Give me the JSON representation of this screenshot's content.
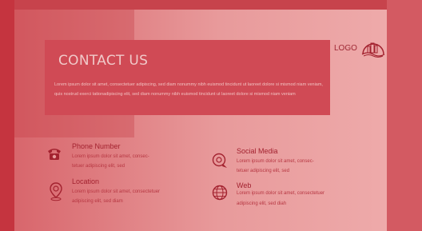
{
  "header": {
    "title": "CONTACT US",
    "text": "Lorem ipsum dolor sit amet, consectetuer adipiscing, sed diam nonummy nibh euismod tincidunt ut laoreet dolore si mismod niam veniam, quis nostrud exerci tationadipiscing elit, sed diam nonummy nibh euismod tincidunt ut laoreet dolore si mismod niam veniam"
  },
  "logo": {
    "label": "LOGO",
    "icon": "city-skyline-logo-icon"
  },
  "contacts": [
    {
      "id": "phone",
      "icon": "phone-icon",
      "title": "Phone Number",
      "line1": "Lorem ipsum dolor sit amet, consec-",
      "line2": "tetuer adipiscing elit, sed"
    },
    {
      "id": "location",
      "icon": "location-pin-icon",
      "title": "Location",
      "line1": "Lorem ipsum dolor sit amet, consectetuer",
      "line2": "adipiscing elit, sed diam"
    },
    {
      "id": "social",
      "icon": "social-chat-icon",
      "title": "Social Media",
      "line1": "Lorem ipsum dolor sit amet, consec-",
      "line2": "tetuer adipiscing elit, sed"
    },
    {
      "id": "web",
      "icon": "globe-icon",
      "title": "Web",
      "line1": "Lorem ipsum dolor sit amet, consectetuer",
      "line2": "adipiscing elit, sed diah"
    }
  ],
  "colors": {
    "accent": "#a3222f",
    "hero": "#d04a55",
    "background": "#c9424d"
  }
}
